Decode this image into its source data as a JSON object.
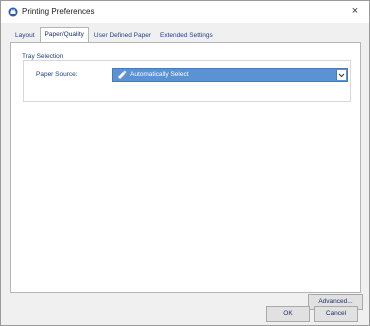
{
  "window": {
    "title": "Printing Preferences",
    "close_glyph": "×"
  },
  "tabs": [
    {
      "label": "Layout"
    },
    {
      "label": "Paper/Quality"
    },
    {
      "label": "User Defined Paper"
    },
    {
      "label": "Extended Settings"
    }
  ],
  "tray_selection": {
    "group_label": "Tray Selection",
    "paper_source_label": "Paper Source:",
    "paper_source_value": "Automatically Select",
    "icon": "printer-tray-icon"
  },
  "buttons": {
    "advanced": "Advanced...",
    "ok": "OK",
    "cancel": "Cancel"
  },
  "colors": {
    "selection_blue": "#5a92d4",
    "label_blue": "#23407f"
  }
}
